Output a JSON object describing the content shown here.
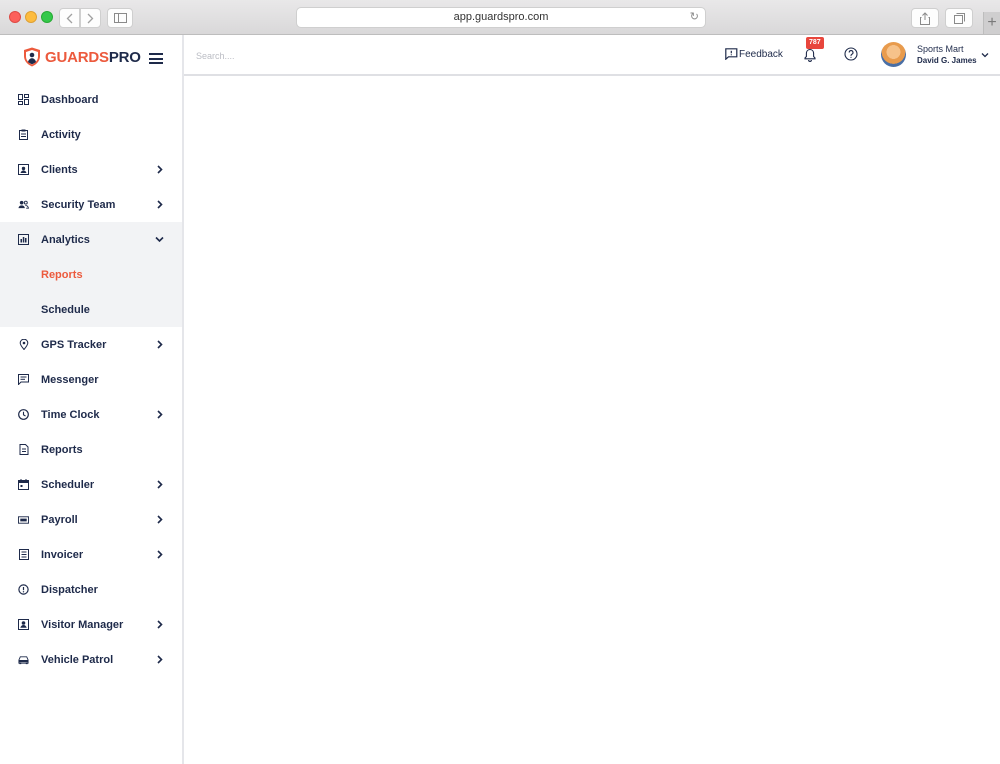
{
  "browser": {
    "url": "app.guardspro.com"
  },
  "brand": {
    "part1": "GUARDS",
    "part2": "PRO",
    "accent_color": "#ec5a3d",
    "text_color": "#1e2a4a"
  },
  "sidebar": {
    "items": [
      {
        "label": "Dashboard",
        "icon": "dashboard-icon",
        "chevron": false
      },
      {
        "label": "Activity",
        "icon": "clipboard-icon",
        "chevron": false
      },
      {
        "label": "Clients",
        "icon": "contact-card-icon",
        "chevron": true
      },
      {
        "label": "Security Team",
        "icon": "people-icon",
        "chevron": true
      },
      {
        "label": "Analytics",
        "icon": "analytics-icon",
        "chevron": "down",
        "expanded": true,
        "children": [
          {
            "label": "Reports",
            "active": true
          },
          {
            "label": "Schedule",
            "active": false
          }
        ]
      },
      {
        "label": "GPS Tracker",
        "icon": "location-pin-icon",
        "chevron": true
      },
      {
        "label": "Messenger",
        "icon": "message-icon",
        "chevron": false
      },
      {
        "label": "Time Clock",
        "icon": "clock-icon",
        "chevron": true
      },
      {
        "label": "Reports",
        "icon": "document-icon",
        "chevron": false
      },
      {
        "label": "Scheduler",
        "icon": "calendar-icon",
        "chevron": true
      },
      {
        "label": "Payroll",
        "icon": "money-icon",
        "chevron": true
      },
      {
        "label": "Invoicer",
        "icon": "invoice-icon",
        "chevron": true
      },
      {
        "label": "Dispatcher",
        "icon": "alert-circle-icon",
        "chevron": false
      },
      {
        "label": "Visitor Manager",
        "icon": "visitor-badge-icon",
        "chevron": true
      },
      {
        "label": "Vehicle Patrol",
        "icon": "car-icon",
        "chevron": true
      }
    ]
  },
  "topbar": {
    "search_placeholder": "Search....",
    "feedback_label": "Feedback",
    "notification_count": "787",
    "company": "Sports Mart",
    "user": "David G. James"
  }
}
